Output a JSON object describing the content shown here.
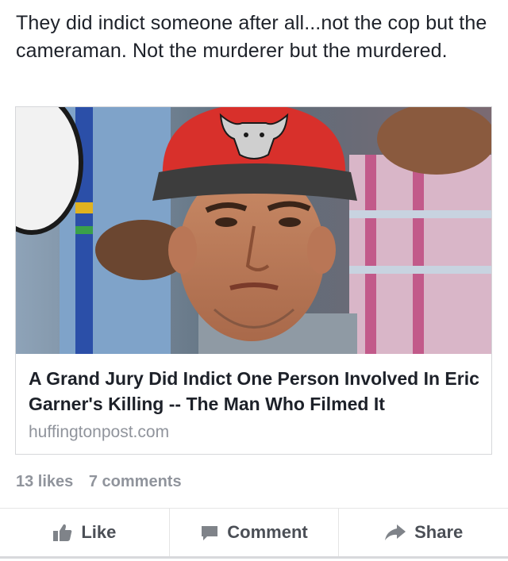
{
  "post": {
    "text": "They did indict someone after all...not the cop but the cameraman. Not the murderer but the murdered."
  },
  "link": {
    "image_description_icon": "photo-thumbnail",
    "title": "A Grand Jury Did Indict One Person Involved In Eric Garner's Killing -- The Man Who Filmed It",
    "domain": "huffingtonpost.com"
  },
  "stats": {
    "likes": "13 likes",
    "comments": "7 comments"
  },
  "actions": {
    "like_label": "Like",
    "like_icon": "thumbs-up-icon",
    "comment_label": "Comment",
    "comment_icon": "speech-bubble-icon",
    "share_label": "Share",
    "share_icon": "share-arrow-icon"
  },
  "colors": {
    "text": "#1d2129",
    "muted": "#90949c",
    "action_text": "#4b4f56",
    "cap_red": "#d8302b"
  }
}
